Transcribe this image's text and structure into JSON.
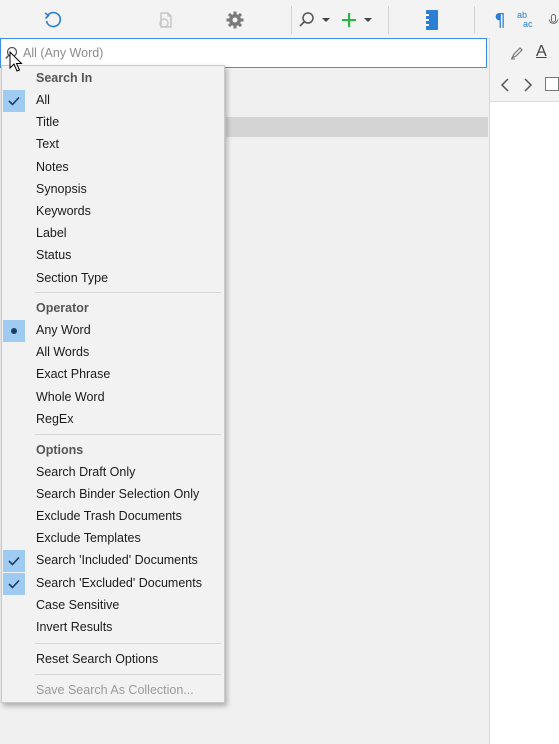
{
  "toolbar": {
    "icons": [
      "sync-icon",
      "disabled-snapshot-icon",
      "gear-icon",
      "search-icon",
      "chevron-down-icon",
      "add-icon",
      "chevron-down-icon",
      "composition-book-icon",
      "pilcrow-icon",
      "ab-ac-replace-icon",
      "microphone-icon"
    ],
    "pilcrow": "¶",
    "ab": "ab",
    "ac": "ac"
  },
  "search": {
    "placeholder": "All (Any Word)",
    "value": ""
  },
  "menu": {
    "search_in": {
      "header": "Search In",
      "items": [
        {
          "label": "All",
          "checked": true
        },
        {
          "label": "Title",
          "checked": false
        },
        {
          "label": "Text",
          "checked": false
        },
        {
          "label": "Notes",
          "checked": false
        },
        {
          "label": "Synopsis",
          "checked": false
        },
        {
          "label": "Keywords",
          "checked": false
        },
        {
          "label": "Label",
          "checked": false
        },
        {
          "label": "Status",
          "checked": false
        },
        {
          "label": "Section Type",
          "checked": false
        }
      ]
    },
    "operator": {
      "header": "Operator",
      "items": [
        {
          "label": "Any Word",
          "selected": true
        },
        {
          "label": "All Words",
          "selected": false
        },
        {
          "label": "Exact Phrase",
          "selected": false
        },
        {
          "label": "Whole Word",
          "selected": false
        },
        {
          "label": "RegEx",
          "selected": false
        }
      ]
    },
    "options": {
      "header": "Options",
      "items": [
        {
          "label": "Search Draft Only",
          "checked": false
        },
        {
          "label": "Search Binder Selection Only",
          "checked": false
        },
        {
          "label": "Exclude Trash Documents",
          "checked": false
        },
        {
          "label": "Exclude Templates",
          "checked": false
        },
        {
          "label": "Search 'Included' Documents",
          "checked": true
        },
        {
          "label": "Search 'Excluded' Documents",
          "checked": true
        },
        {
          "label": "Case Sensitive",
          "checked": false
        },
        {
          "label": "Invert Results",
          "checked": false
        }
      ]
    },
    "reset": "Reset Search Options",
    "save": "Save Search As Collection...",
    "save_enabled": false
  },
  "format_bar": {
    "icons": [
      "highlighter-icon",
      "text-color-icon"
    ],
    "text_color_letter": "A"
  },
  "nav_bar": {
    "icons": [
      "back-arrow-icon",
      "forward-arrow-icon",
      "checkbox-icon"
    ]
  },
  "colors": {
    "accent": "#2a7fd4",
    "green_add": "#2db34a",
    "check_highlight": "#9fcaf2",
    "search_border": "#3c8ee6"
  }
}
